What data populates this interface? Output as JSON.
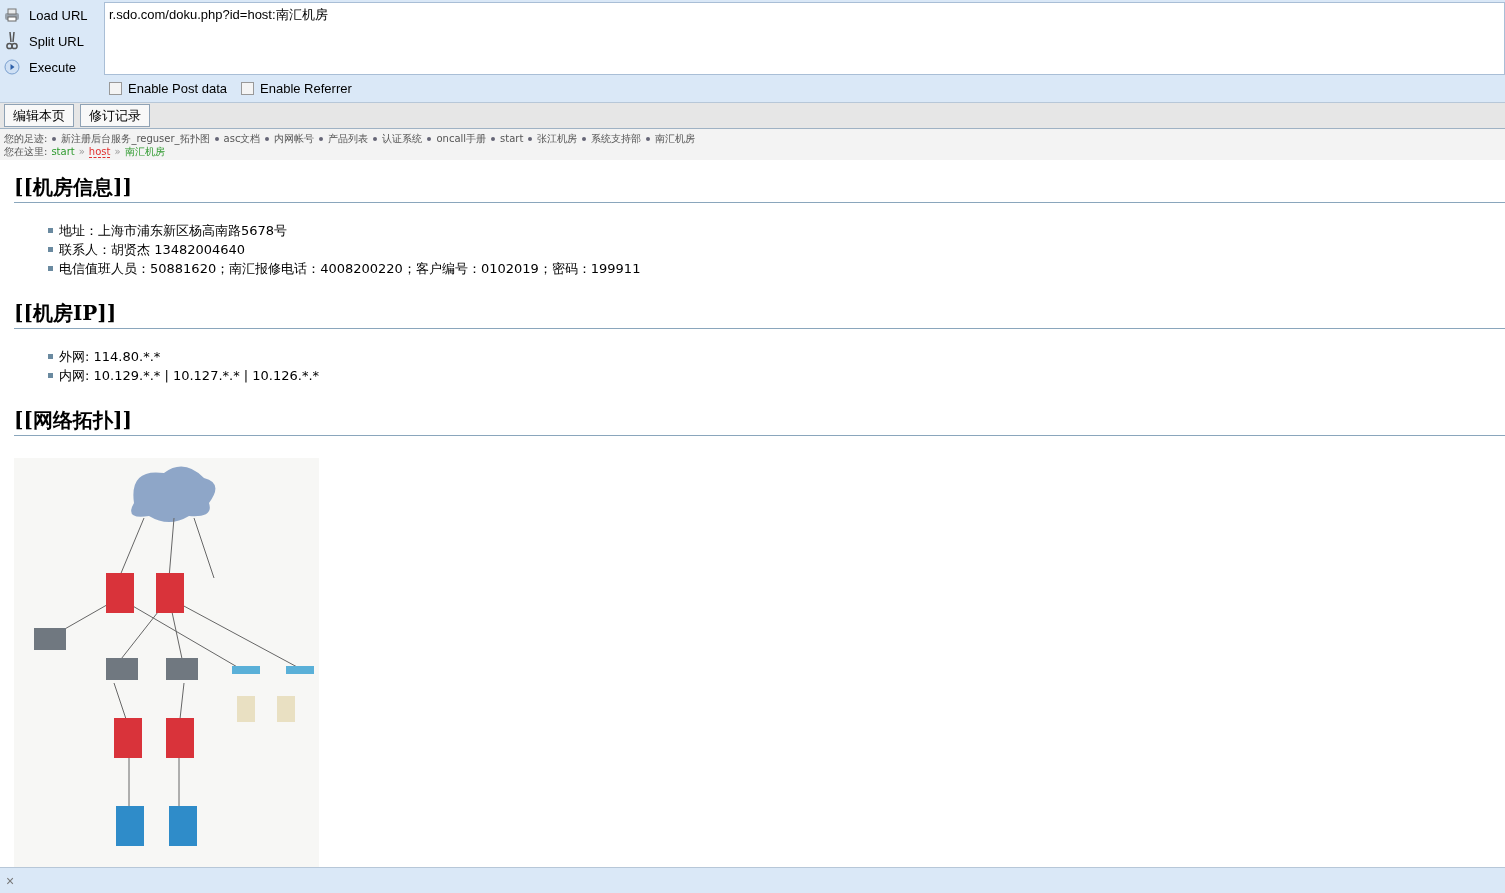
{
  "toolbar": {
    "actions": [
      {
        "label": "Load URL",
        "kind": "load"
      },
      {
        "label": "Split URL",
        "kind": "split"
      },
      {
        "label": "Execute",
        "kind": "execute"
      }
    ],
    "url": "r.sdo.com/doku.php?id=host:南汇机房",
    "options": [
      {
        "label": "Enable Post data",
        "checked": false
      },
      {
        "label": "Enable Referrer",
        "checked": false
      }
    ]
  },
  "page_buttons": [
    "编辑本页",
    "修订记录"
  ],
  "trace": {
    "label": "您的足迹:",
    "items": [
      "新注册后台服务_reguser_拓扑图",
      "asc文档",
      "内网帐号",
      "产品列表",
      "认证系统",
      "oncall手册",
      "start",
      "张江机房",
      "系统支持部",
      "南汇机房"
    ]
  },
  "breadcrumb": {
    "label": "您在这里:",
    "separator": "»",
    "items": [
      {
        "text": "start",
        "kind": "link"
      },
      {
        "text": "host",
        "kind": "missing"
      },
      {
        "text": "南汇机房",
        "kind": "link"
      }
    ]
  },
  "sections": [
    {
      "heading": "[[机房信息]]",
      "items": [
        "地址：上海市浦东新区杨高南路5678号",
        "联系人：胡贤杰 13482004640",
        "电信值班人员：50881620；南汇报修电话：4008200220；客户编号：0102019；密码：199911"
      ]
    },
    {
      "heading": "[[机房IP]]",
      "items": [
        "外网: 114.80.*.*",
        "内网: 10.129.*.* | 10.127.*.* | 10.126.*.*"
      ]
    },
    {
      "heading": "[[网络拓扑]]"
    }
  ],
  "bottom_bar": {
    "close": "×"
  }
}
